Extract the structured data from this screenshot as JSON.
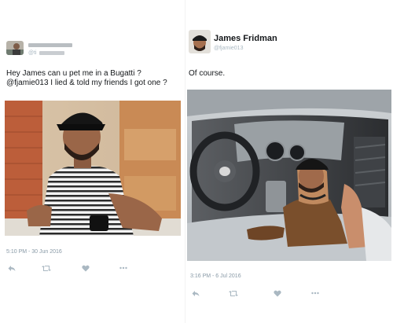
{
  "left_tweet": {
    "handle_fragment": "@ti",
    "text_line1": "Hey James can u pet me in a Bugatti ?",
    "text_line2": "@fjamie013  I lied & told my friends I got one ?",
    "timestamp": "5:10 PM - 30 Jun 2016"
  },
  "right_tweet": {
    "display_name": "James Fridman",
    "handle": "@fjamie013",
    "text": "Of course.",
    "timestamp": "3:16 PM - 6 Jul 2016"
  },
  "icons": [
    "reply-icon",
    "retweet-icon",
    "like-icon",
    "more-icon"
  ],
  "colors": {
    "icon_gray": "#aab8c2",
    "meta_gray": "#8899a6",
    "text": "#14171a"
  }
}
